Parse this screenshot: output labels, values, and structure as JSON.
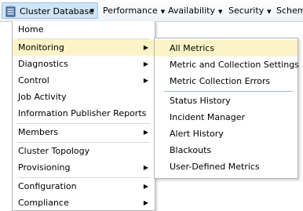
{
  "menubar": {
    "items": [
      {
        "label": "Cluster Database",
        "icon": "database-icon",
        "active": true
      },
      {
        "label": "Performance"
      },
      {
        "label": "Availability"
      },
      {
        "label": "Security"
      },
      {
        "label": "Schema"
      }
    ]
  },
  "main_menu": {
    "items": [
      {
        "label": "Home",
        "submenu": false
      },
      {
        "label": "Monitoring",
        "submenu": true,
        "highlighted": true
      },
      {
        "label": "Diagnostics",
        "submenu": true
      },
      {
        "label": "Control",
        "submenu": true
      },
      {
        "label": "Job Activity",
        "submenu": false
      },
      {
        "label": "Information Publisher Reports",
        "submenu": false
      },
      {
        "label": "Members",
        "submenu": true
      },
      {
        "label": "Cluster Topology",
        "submenu": false
      },
      {
        "label": "Provisioning",
        "submenu": true
      },
      {
        "label": "Configuration",
        "submenu": true
      },
      {
        "label": "Compliance",
        "submenu": true
      }
    ]
  },
  "monitoring_submenu": {
    "items": [
      {
        "label": "All Metrics",
        "highlighted": true
      },
      {
        "label": "Metric and Collection Settings"
      },
      {
        "label": "Metric Collection Errors"
      },
      {
        "label": "Status History"
      },
      {
        "label": "Incident Manager"
      },
      {
        "label": "Alert History"
      },
      {
        "label": "Blackouts"
      },
      {
        "label": "User-Defined Metrics"
      }
    ]
  },
  "colors": {
    "highlight": "#fcf4c6",
    "active_menubar_bg": "#cfe4f5",
    "separator": "#d4d9de"
  }
}
